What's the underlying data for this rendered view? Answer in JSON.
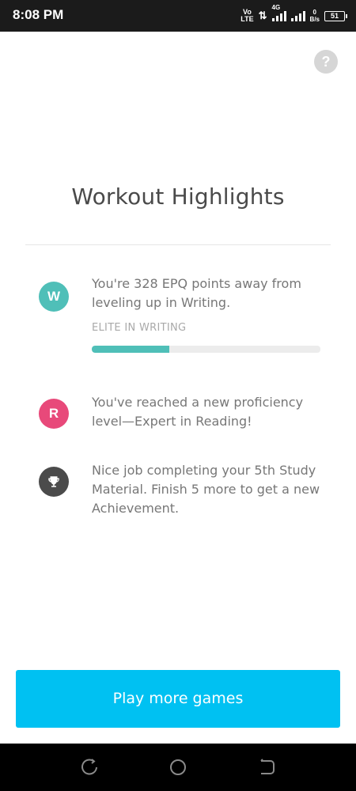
{
  "status_bar": {
    "time": "8:08 PM",
    "volte_top": "Vo",
    "volte_bottom": "LTE",
    "arrows": "⇅",
    "network_tag": "4G",
    "netspeed_value": "0",
    "netspeed_unit": "B/s",
    "battery": "51"
  },
  "help": {
    "label": "?"
  },
  "page": {
    "title": "Workout Highlights"
  },
  "highlights": [
    {
      "icon_letter": "W",
      "text": "You're 328 EPQ points away from leveling up in Writing.",
      "level_label": "ELITE IN WRITING",
      "progress": 0.34
    },
    {
      "icon_letter": "R",
      "text": "You've reached a new proficiency level—Expert in Reading!"
    },
    {
      "icon": "trophy-icon",
      "text": "Nice job completing your 5th Study Material. Finish 5 more to get a new Achievement."
    }
  ],
  "cta": {
    "label": "Play more games"
  },
  "colors": {
    "writing": "#4fbfb8",
    "reading": "#e8497a",
    "trophy": "#4b4b4b",
    "cta": "#00c1f2"
  }
}
